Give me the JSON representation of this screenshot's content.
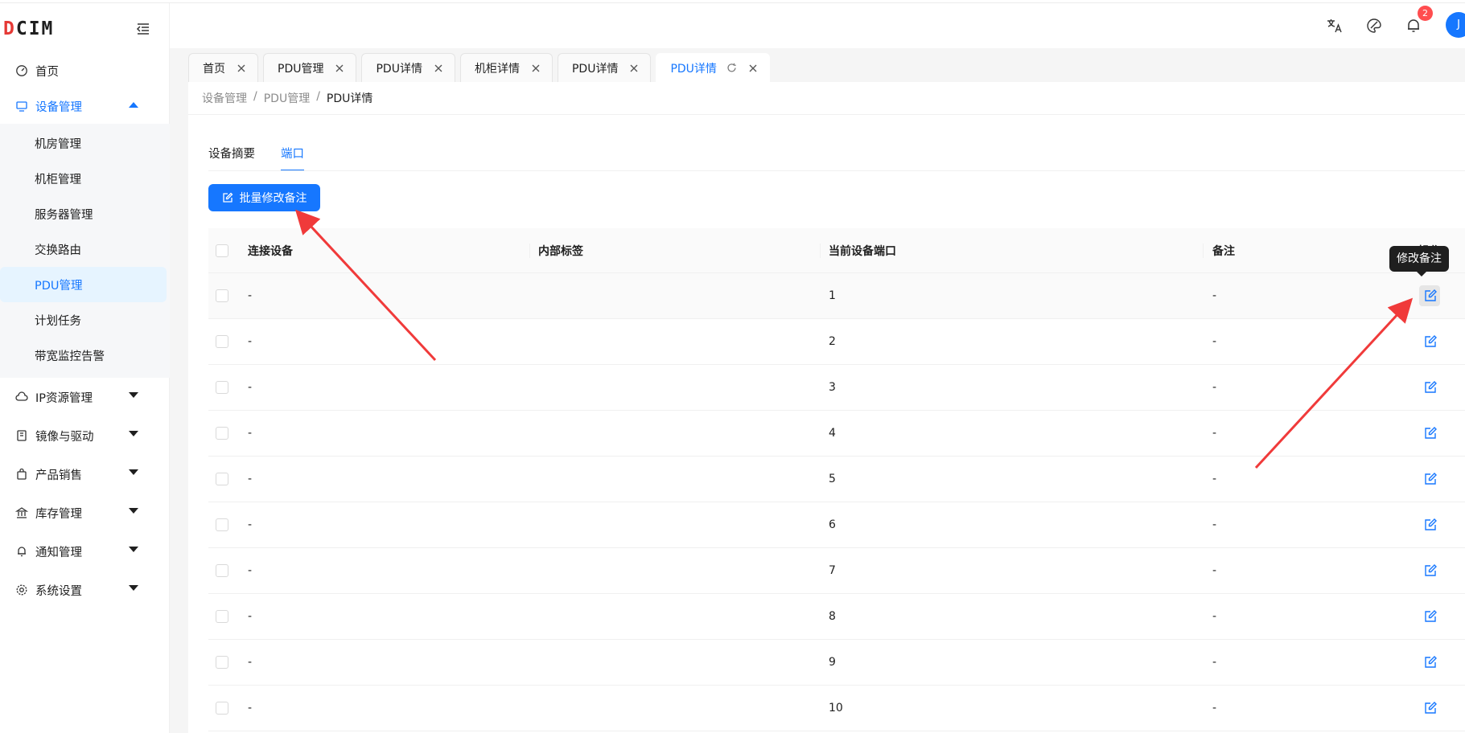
{
  "app": {
    "logo_text": "CIM",
    "logo_accent": "D"
  },
  "header": {
    "notification_count": "2",
    "avatar_initial": "J"
  },
  "sidebar": {
    "items": [
      {
        "label": "首页",
        "icon": "dashboard-icon"
      },
      {
        "label": "设备管理",
        "icon": "monitor-icon",
        "expanded": true,
        "children": [
          "机房管理",
          "机柜管理",
          "服务器管理",
          "交换路由",
          "PDU管理",
          "计划任务",
          "带宽监控告警"
        ],
        "selected_child": "PDU管理"
      },
      {
        "label": "IP资源管理",
        "icon": "cloud-icon"
      },
      {
        "label": "镜像与驱动",
        "icon": "book-icon"
      },
      {
        "label": "产品销售",
        "icon": "shopping-bag-icon"
      },
      {
        "label": "库存管理",
        "icon": "bank-icon"
      },
      {
        "label": "通知管理",
        "icon": "bell-icon"
      },
      {
        "label": "系统设置",
        "icon": "gear-icon"
      }
    ]
  },
  "tabs": [
    {
      "label": "首页"
    },
    {
      "label": "PDU管理"
    },
    {
      "label": "PDU详情"
    },
    {
      "label": "机柜详情"
    },
    {
      "label": "PDU详情"
    },
    {
      "label": "PDU详情",
      "active": true
    }
  ],
  "breadcrumb": [
    "设备管理",
    "PDU管理",
    "PDU详情"
  ],
  "subtabs": [
    {
      "label": "设备摘要"
    },
    {
      "label": "端口",
      "active": true
    }
  ],
  "batch_button": "批量修改备注",
  "table": {
    "columns": [
      "连接设备",
      "内部标签",
      "当前设备端口",
      "备注",
      "操作"
    ],
    "rows": [
      {
        "device": "-",
        "tag": "",
        "port": "1",
        "note": "-"
      },
      {
        "device": "-",
        "tag": "",
        "port": "2",
        "note": "-"
      },
      {
        "device": "-",
        "tag": "",
        "port": "3",
        "note": "-"
      },
      {
        "device": "-",
        "tag": "",
        "port": "4",
        "note": "-"
      },
      {
        "device": "-",
        "tag": "",
        "port": "5",
        "note": "-"
      },
      {
        "device": "-",
        "tag": "",
        "port": "6",
        "note": "-"
      },
      {
        "device": "-",
        "tag": "",
        "port": "7",
        "note": "-"
      },
      {
        "device": "-",
        "tag": "",
        "port": "8",
        "note": "-"
      },
      {
        "device": "-",
        "tag": "",
        "port": "9",
        "note": "-"
      },
      {
        "device": "-",
        "tag": "",
        "port": "10",
        "note": "-"
      }
    ]
  },
  "tooltip": "修改备注",
  "colors": {
    "primary": "#1677ff",
    "annotation": "#f03a3a",
    "badge": "#ff4d4f"
  }
}
